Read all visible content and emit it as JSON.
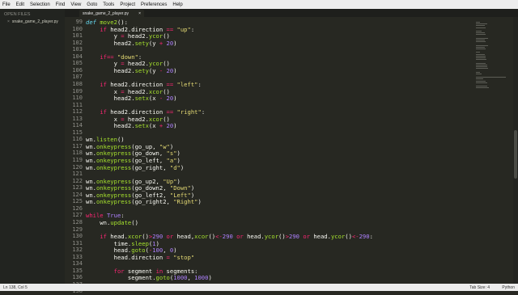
{
  "menu": [
    "File",
    "Edit",
    "Selection",
    "Find",
    "View",
    "Goto",
    "Tools",
    "Project",
    "Preferences",
    "Help"
  ],
  "sidebar": {
    "header": "OPEN FILES",
    "file": "snake_game_2_player.py"
  },
  "tab": {
    "label": "snake_game_2_player.py",
    "close": "×"
  },
  "code": [
    {
      "n": "99",
      "t": [
        [
          "def",
          "def "
        ],
        [
          "fn",
          "move2"
        ],
        [
          "",
          "():"
        ]
      ]
    },
    {
      "n": "100",
      "t": [
        [
          "",
          "    "
        ],
        [
          "kw",
          "if"
        ],
        [
          "",
          " head2.direction "
        ],
        [
          "kw",
          "=="
        ],
        [
          "str",
          " \"up\""
        ],
        [
          "",
          ":"
        ]
      ]
    },
    {
      "n": "101",
      "t": [
        [
          "",
          "        y "
        ],
        [
          "kw",
          "="
        ],
        [
          "",
          " head2."
        ],
        [
          "fn",
          "ycor"
        ],
        [
          "",
          "()"
        ]
      ]
    },
    {
      "n": "102",
      "t": [
        [
          "",
          "        head2."
        ],
        [
          "fn",
          "sety"
        ],
        [
          "",
          "(y "
        ],
        [
          "kw",
          "+"
        ],
        [
          "num",
          " 20"
        ],
        [
          "",
          ")"
        ]
      ]
    },
    {
      "n": "103",
      "t": []
    },
    {
      "n": "104",
      "t": [
        [
          "",
          "    "
        ],
        [
          "kw",
          "if"
        ],
        [
          "",
          "",
          " head2.direction "
        ],
        [
          "kw",
          "=="
        ],
        [
          "str",
          " \"down\""
        ],
        [
          "",
          ":"
        ]
      ]
    },
    {
      "n": "105",
      "t": [
        [
          "",
          "        y "
        ],
        [
          "kw",
          "="
        ],
        [
          "",
          " head2."
        ],
        [
          "fn",
          "ycor"
        ],
        [
          "",
          "()"
        ]
      ]
    },
    {
      "n": "106",
      "t": [
        [
          "",
          "        head2."
        ],
        [
          "fn",
          "sety"
        ],
        [
          "",
          "(y "
        ],
        [
          "kw",
          "-"
        ],
        [
          "num",
          " 20"
        ],
        [
          "",
          ")"
        ]
      ]
    },
    {
      "n": "107",
      "t": []
    },
    {
      "n": "108",
      "t": [
        [
          "",
          "    "
        ],
        [
          "kw",
          "if"
        ],
        [
          "",
          " head2.direction "
        ],
        [
          "kw",
          "=="
        ],
        [
          "str",
          " \"left\""
        ],
        [
          "",
          ":"
        ]
      ]
    },
    {
      "n": "109",
      "t": [
        [
          "",
          "        x "
        ],
        [
          "kw",
          "="
        ],
        [
          "",
          " head2."
        ],
        [
          "fn",
          "xcor"
        ],
        [
          "",
          "()"
        ]
      ]
    },
    {
      "n": "110",
      "t": [
        [
          "",
          "        head2."
        ],
        [
          "fn",
          "setx"
        ],
        [
          "",
          "(x "
        ],
        [
          "kw",
          "-"
        ],
        [
          "num",
          " 20"
        ],
        [
          "",
          ")"
        ]
      ]
    },
    {
      "n": "111",
      "t": []
    },
    {
      "n": "112",
      "t": [
        [
          "",
          "    "
        ],
        [
          "kw",
          "if"
        ],
        [
          "",
          " head2.direction "
        ],
        [
          "kw",
          "=="
        ],
        [
          "str",
          " \"right\""
        ],
        [
          "",
          ":"
        ]
      ]
    },
    {
      "n": "113",
      "t": [
        [
          "",
          "        x "
        ],
        [
          "kw",
          "="
        ],
        [
          "",
          " head2."
        ],
        [
          "fn",
          "xcor"
        ],
        [
          "",
          "()"
        ]
      ]
    },
    {
      "n": "114",
      "t": [
        [
          "",
          "        head2."
        ],
        [
          "fn",
          "setx"
        ],
        [
          "",
          "(x "
        ],
        [
          "kw",
          "+"
        ],
        [
          "num",
          " 20"
        ],
        [
          "",
          ")"
        ]
      ]
    },
    {
      "n": "115",
      "t": []
    },
    {
      "n": "116",
      "t": [
        [
          "",
          "wn."
        ],
        [
          "fn",
          "listen"
        ],
        [
          "",
          "()"
        ]
      ]
    },
    {
      "n": "117",
      "t": [
        [
          "",
          "wn."
        ],
        [
          "fn",
          "onkeypress"
        ],
        [
          "",
          "(go_up, "
        ],
        [
          "str",
          "\"w\""
        ],
        [
          "",
          ")"
        ]
      ]
    },
    {
      "n": "118",
      "t": [
        [
          "",
          "wn."
        ],
        [
          "fn",
          "onkeypress"
        ],
        [
          "",
          "(go_down, "
        ],
        [
          "str",
          "\"s\""
        ],
        [
          "",
          ")"
        ]
      ]
    },
    {
      "n": "119",
      "t": [
        [
          "",
          "wn."
        ],
        [
          "fn",
          "onkeypress"
        ],
        [
          "",
          "(go_left, "
        ],
        [
          "str",
          "\"a\""
        ],
        [
          "",
          ")"
        ]
      ]
    },
    {
      "n": "120",
      "t": [
        [
          "",
          "wn."
        ],
        [
          "fn",
          "onkeypress"
        ],
        [
          "",
          "(go_right, "
        ],
        [
          "str",
          "\"d\""
        ],
        [
          "",
          ")"
        ]
      ]
    },
    {
      "n": "121",
      "t": []
    },
    {
      "n": "122",
      "t": [
        [
          "",
          "wn."
        ],
        [
          "fn",
          "onkeypress"
        ],
        [
          "",
          "(go_up2, "
        ],
        [
          "str",
          "\"Up\""
        ],
        [
          "",
          ")"
        ]
      ]
    },
    {
      "n": "123",
      "t": [
        [
          "",
          "wn."
        ],
        [
          "fn",
          "onkeypress"
        ],
        [
          "",
          "(go_down2, "
        ],
        [
          "str",
          "\"Down\""
        ],
        [
          "",
          ")"
        ]
      ]
    },
    {
      "n": "124",
      "t": [
        [
          "",
          "wn."
        ],
        [
          "fn",
          "onkeypress"
        ],
        [
          "",
          "(go_left2, "
        ],
        [
          "str",
          "\"Left\""
        ],
        [
          "",
          ")"
        ]
      ]
    },
    {
      "n": "125",
      "t": [
        [
          "",
          "wn."
        ],
        [
          "fn",
          "onkeypress"
        ],
        [
          "",
          "(go_right2, "
        ],
        [
          "str",
          "\"Right\""
        ],
        [
          "",
          ")"
        ]
      ]
    },
    {
      "n": "126",
      "t": []
    },
    {
      "n": "127",
      "t": [
        [
          "kw",
          "while"
        ],
        [
          "num",
          " True"
        ],
        [
          "",
          ":"
        ]
      ]
    },
    {
      "n": "128",
      "t": [
        [
          "",
          "    wn."
        ],
        [
          "fn",
          "update"
        ],
        [
          "",
          "()"
        ]
      ]
    },
    {
      "n": "129",
      "t": []
    },
    {
      "n": "130",
      "t": [
        [
          "",
          "    "
        ],
        [
          "kw",
          "if"
        ],
        [
          "",
          " head."
        ],
        [
          "fn",
          "xcor"
        ],
        [
          "",
          "()"
        ],
        [
          "kw",
          ">"
        ],
        [
          "num",
          "290"
        ],
        [
          "kw",
          " or"
        ],
        [
          "",
          " head,"
        ],
        [
          "fn",
          "xcor"
        ],
        [
          "",
          "()"
        ],
        [
          "kw",
          "<"
        ],
        [
          "kw",
          "-"
        ],
        [
          "num",
          "290"
        ],
        [
          "kw",
          " or"
        ],
        [
          "",
          " head."
        ],
        [
          "fn",
          "ycor"
        ],
        [
          "",
          "()"
        ],
        [
          "kw",
          ">"
        ],
        [
          "num",
          "290"
        ],
        [
          "kw",
          " or"
        ],
        [
          "",
          " head."
        ],
        [
          "fn",
          "ycor"
        ],
        [
          "",
          "()"
        ],
        [
          "kw",
          "<"
        ],
        [
          "kw",
          "-"
        ],
        [
          "num",
          "290"
        ],
        [
          "",
          ":"
        ]
      ]
    },
    {
      "n": "131",
      "t": [
        [
          "",
          "        time."
        ],
        [
          "fn",
          "sleep"
        ],
        [
          "",
          "("
        ],
        [
          "num",
          "1"
        ],
        [
          "",
          ")"
        ]
      ]
    },
    {
      "n": "132",
      "t": [
        [
          "",
          "        head."
        ],
        [
          "fn",
          "goto"
        ],
        [
          "",
          "("
        ],
        [
          "kw",
          "-"
        ],
        [
          "num",
          "100"
        ],
        [
          "",
          ", "
        ],
        [
          "num",
          "0"
        ],
        [
          "",
          ")"
        ]
      ]
    },
    {
      "n": "133",
      "t": [
        [
          "",
          "        head.direction "
        ],
        [
          "kw",
          "="
        ],
        [
          "str",
          " \"stop\""
        ]
      ]
    },
    {
      "n": "134",
      "t": []
    },
    {
      "n": "135",
      "t": [
        [
          "",
          "        "
        ],
        [
          "kw",
          "for"
        ],
        [
          "",
          " segment "
        ],
        [
          "kw",
          "in"
        ],
        [
          "",
          " segments:"
        ]
      ]
    },
    {
      "n": "136",
      "t": [
        [
          "",
          "            segment."
        ],
        [
          "fn",
          "goto"
        ],
        [
          "",
          "("
        ],
        [
          "num",
          "1000"
        ],
        [
          "",
          ", "
        ],
        [
          "num",
          "1000"
        ],
        [
          "",
          ")"
        ]
      ]
    },
    {
      "n": "137",
      "t": []
    },
    {
      "n": "138",
      "t": []
    }
  ],
  "status": {
    "left": "Ln 138, Col 5",
    "tab_size": "Tab Size: 4",
    "syntax": "Python"
  }
}
